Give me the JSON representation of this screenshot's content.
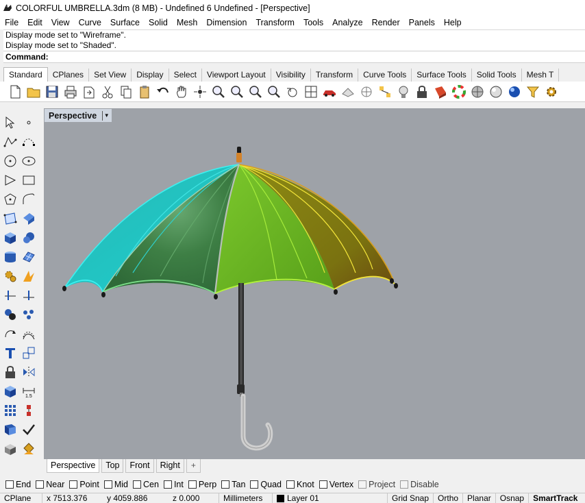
{
  "window": {
    "title": "COLORFUL UMBRELLA.3dm (8 MB) - Undefined 6 Undefined - [Perspective]",
    "icon": "rhino-icon"
  },
  "menu": [
    "File",
    "Edit",
    "View",
    "Curve",
    "Surface",
    "Solid",
    "Mesh",
    "Dimension",
    "Transform",
    "Tools",
    "Analyze",
    "Render",
    "Panels",
    "Help"
  ],
  "history": [
    "Display mode set to \"Wireframe\".",
    "Display mode set to \"Shaded\"."
  ],
  "command": {
    "label": "Command:",
    "value": ""
  },
  "toolbar_tabs": {
    "items": [
      "Standard",
      "CPlanes",
      "Set View",
      "Display",
      "Select",
      "Viewport Layout",
      "Visibility",
      "Transform",
      "Curve Tools",
      "Surface Tools",
      "Solid Tools",
      "Mesh T"
    ],
    "active": "Standard"
  },
  "toolbar_icons": [
    "new-file-icon",
    "open-icon",
    "save-icon",
    "print-icon",
    "import-icon",
    "cut-icon",
    "copy-icon",
    "paste-icon",
    "undo-icon",
    "pan-hand-icon",
    "rotate-view-icon",
    "zoom-dynamic-icon",
    "zoom-window-icon",
    "zoom-extents-icon",
    "zoom-selected-icon",
    "undo-view-icon",
    "four-viewports-icon",
    "car-render-icon",
    "named-views-icon",
    "object-snap-icon",
    "select-points-icon",
    "light-bulb-icon",
    "lock-icon",
    "material-icon",
    "color-wheel-icon",
    "shaded-sphere-icon",
    "rendered-sphere-icon",
    "blue-sphere-icon",
    "filter-icon",
    "settings-gear-icon"
  ],
  "left_tools": [
    [
      "select-arrow-icon",
      "point-icon"
    ],
    [
      "polyline-icon",
      "curve-points-icon"
    ],
    [
      "circle-icon",
      "ellipse-icon"
    ],
    [
      "arc-icon",
      "rectangle-icon"
    ],
    [
      "polygon-icon",
      "fillet-curve-icon"
    ],
    [
      "surface-points-icon",
      "extrude-surface-icon"
    ],
    [
      "box-icon",
      "sphere-icon"
    ],
    [
      "cylinder-icon",
      "mesh-plane-icon"
    ],
    [
      "gear-explode-icon",
      "boolean-spark-icon"
    ],
    [
      "trim-icon",
      "split-icon"
    ],
    [
      "group-icon",
      "points-cloud-icon"
    ],
    [
      "rotate-curve-icon",
      "offset-curve-icon"
    ],
    [
      "text-icon",
      "scale-icon"
    ],
    [
      "block-icon",
      "mirror-icon"
    ],
    [
      "cube-view-icon",
      "dimension-icon"
    ],
    [
      "array-icon",
      "align-icon"
    ],
    [
      "analyze-icon",
      "check-icon"
    ],
    [
      "render-cube-icon",
      "paint-bucket-icon"
    ]
  ],
  "viewport": {
    "title": "Perspective",
    "menu_arrow": "▼"
  },
  "view_tabs": {
    "items": [
      "Perspective",
      "Top",
      "Front",
      "Right"
    ],
    "active": "Perspective",
    "add_tab": "+"
  },
  "osnaps": [
    {
      "label": "End",
      "checked": false,
      "enabled": true
    },
    {
      "label": "Near",
      "checked": false,
      "enabled": true
    },
    {
      "label": "Point",
      "checked": false,
      "enabled": true
    },
    {
      "label": "Mid",
      "checked": false,
      "enabled": true
    },
    {
      "label": "Cen",
      "checked": false,
      "enabled": true
    },
    {
      "label": "Int",
      "checked": false,
      "enabled": true
    },
    {
      "label": "Perp",
      "checked": false,
      "enabled": true
    },
    {
      "label": "Tan",
      "checked": false,
      "enabled": true
    },
    {
      "label": "Quad",
      "checked": false,
      "enabled": true
    },
    {
      "label": "Knot",
      "checked": false,
      "enabled": true
    },
    {
      "label": "Vertex",
      "checked": false,
      "enabled": true
    },
    {
      "label": "Project",
      "checked": false,
      "enabled": false
    },
    {
      "label": "Disable",
      "checked": false,
      "enabled": false
    }
  ],
  "status": {
    "cplane": "CPlane",
    "x": "x 7513.376",
    "y": "y 4059.886",
    "z": "z 0.000",
    "units": "Millimeters",
    "layer": "Layer 01",
    "layer_color": "#000000",
    "grid_snap": "Grid Snap",
    "ortho": "Ortho",
    "planar": "Planar",
    "osnap": "Osnap",
    "smarttrack": "SmartTrack"
  },
  "colors": {
    "viewport_bg": "#9ea2a8",
    "viewport_label_bg": "#cfd6e0",
    "umbrella_cyan": "#1ec8c8",
    "umbrella_green": "#3e8a46",
    "umbrella_lime": "#6fb81e",
    "umbrella_olive": "#8a8a12",
    "edge_yellow": "#f4e63a",
    "edge_cyan": "#3ef0f0"
  }
}
